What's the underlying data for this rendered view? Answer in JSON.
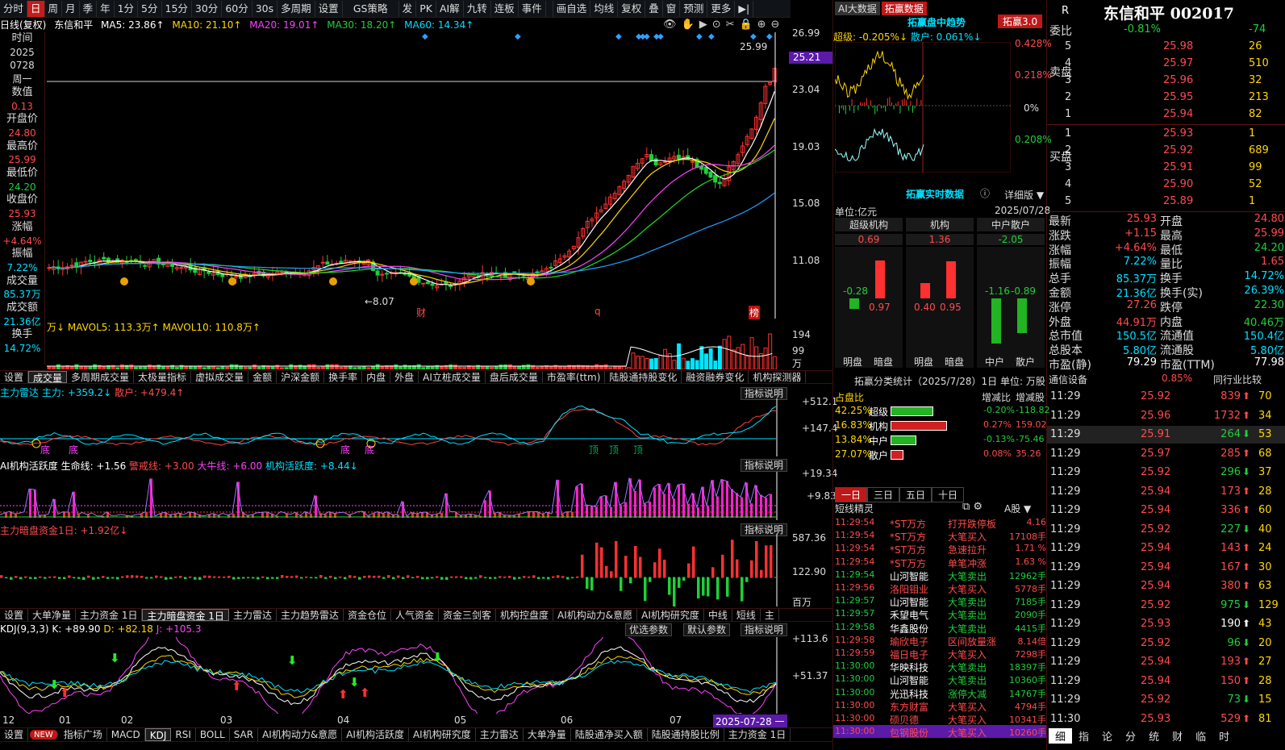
{
  "toolbar": {
    "items": [
      "分时",
      "日",
      "周",
      "月",
      "季",
      "年",
      "1分",
      "5分",
      "15分",
      "30分",
      "60分",
      "30s",
      "多周期",
      "设置",
      "GS策略",
      "发",
      "PK",
      "AI解",
      "九转",
      "连板",
      "事件",
      "",
      "画自选",
      "均线",
      "复权",
      "叠",
      "窗",
      "预测",
      "更多",
      "▶|"
    ],
    "active_index": 1
  },
  "header": {
    "mode": "日线(复权)",
    "stock": "东信和平",
    "ma5": "MA5: 23.86↑",
    "ma10": "MA10: 21.10↑",
    "ma20": "MA20: 19.01↑",
    "ma30": "MA30: 18.20↑",
    "ma60": "MA60: 14.34↑"
  },
  "left_info": [
    {
      "label": "时间",
      "value": "2025",
      "value2": "0728",
      "value3": "周一"
    },
    {
      "label": "数值",
      "value": "0.13"
    },
    {
      "label": "开盘价",
      "value": "24.80"
    },
    {
      "label": "最高价",
      "value": "25.99"
    },
    {
      "label": "最低价",
      "value": "24.20"
    },
    {
      "label": "收盘价",
      "value": "25.93"
    },
    {
      "label": "涨幅",
      "value": "+4.64%"
    },
    {
      "label": "振幅",
      "value": "7.22%"
    },
    {
      "label": "成交量",
      "value": "85.37万"
    },
    {
      "label": "成交额",
      "value": "21.36亿"
    },
    {
      "label": "换手",
      "value": "14.72%"
    }
  ],
  "price_axis": [
    "26.99",
    "25.21",
    "23.04",
    "19.03",
    "15.08",
    "11.08"
  ],
  "price_marks": {
    "high": "25.99",
    "low": "←8.07",
    "event1": "财",
    "event2": "q",
    "event3": "榜"
  },
  "volume": {
    "header": "万↓ MAVOL5: 113.3万↑ MAVOL10: 110.8万↑",
    "axis": [
      "194",
      "99",
      "万"
    ]
  },
  "tabs1": [
    "设置",
    "成交量",
    "多周期成交量",
    "太极量指标",
    "虚拟成交量",
    "金额",
    "沪深金额",
    "换手率",
    "内盘",
    "外盘",
    "AI立桩成交量",
    "盘后成交量",
    "市盈率(ttm)",
    "陆股通持股变化",
    "融资融券变化",
    "机构探测器"
  ],
  "tabs1_selected": 1,
  "radar": {
    "title": "主力雷达",
    "main": "主力: +359.2↓",
    "retail": "散户: +479.4↑",
    "axis": [
      "+512.1",
      "+147.4"
    ],
    "labels": [
      "底",
      "底",
      "顶",
      "顶",
      "顶",
      "底",
      "底"
    ]
  },
  "ai": {
    "title": "AI机构活跃度",
    "life": "生命线: +1.56",
    "warn": "警戒线: +3.00",
    "bull": "大牛线: +6.00",
    "act": "机构活跃度: +8.44↓",
    "axis": [
      "+19.34",
      "+9.83"
    ]
  },
  "dark": {
    "title": "主力暗盘资金1日: +1.92亿↓",
    "axis": [
      "587.36",
      "122.90",
      "百万"
    ]
  },
  "explain_label": "指标说明",
  "tabs2": [
    "设置",
    "大单净量",
    "主力资金 1日",
    "主力暗盘资金 1日",
    "主力雷达",
    "主力趋势雷达",
    "资金仓位",
    "人气资金",
    "资金三剑客",
    "机构控盘度",
    "AI机构动力&意愿",
    "AI机构研究度",
    "中线",
    "短线",
    "主"
  ],
  "tabs2_selected": 3,
  "kdj": {
    "title": "KDJ(9,3,3)",
    "k": "K: +89.90",
    "d": "D: +82.18",
    "j": "J: +105.3",
    "axis": [
      "+113.6",
      "+51.37"
    ],
    "btn_opt": "优选参数",
    "btn_def": "默认参数"
  },
  "dates": [
    "12",
    "01",
    "02",
    "03",
    "04",
    "05",
    "06",
    "07",
    "2025-07-28 一"
  ],
  "bottom_tabs": [
    "设置",
    "NEW",
    "指标广场",
    "MACD",
    "KDJ",
    "RSI",
    "BOLL",
    "SAR",
    "AI机构动力&意愿",
    "AI机构活跃度",
    "AI机构研究度",
    "主力雷达",
    "大单净量",
    "陆股通净买入额",
    "陆股通持股比例",
    "主力资金 1日"
  ],
  "bottom_selected": 4,
  "mid": {
    "tabs": [
      "AI大数据",
      "拓赢数据"
    ],
    "trend_title": "拓赢盘中趋势",
    "brand": "拓赢3.0",
    "super_label": "超级: -0.205%↓",
    "retail_label": "散户: 0.061%↓",
    "trend_axis": [
      "0.428%",
      "0.218%",
      "0%",
      "0.208%"
    ],
    "realtime_title": "拓赢实时数据",
    "detail": "详细版",
    "unit": "单位:亿元",
    "date": "2025/07/28",
    "groups": [
      {
        "name": "超级机构",
        "val": "0.69",
        "a": "-0.28",
        "b": "0.97",
        "la": "明盘",
        "lb": "暗盘"
      },
      {
        "name": "机构",
        "val": "1.36",
        "a": "0.40",
        "b": "0.95",
        "la": "明盘",
        "lb": "暗盘"
      },
      {
        "name": "中户散户",
        "val": "-2.05",
        "a": "-1.16",
        "b": "-0.89",
        "la": "中户",
        "lb": "散户"
      }
    ],
    "stats_title": "拓赢分类统计（2025/7/28）1日  单位: 万股",
    "stats_head": [
      "占盘比",
      "增减比",
      "增减股"
    ],
    "stats": [
      {
        "pct": "42.25%",
        "name": "超级",
        "chg": "-0.20%",
        "shares": "-118.82",
        "bar": 0.5,
        "color": "#22b422"
      },
      {
        "pct": "16.83%",
        "name": "机构",
        "chg": "0.27%",
        "shares": "159.02",
        "bar": 0.66,
        "color": "#d02020"
      },
      {
        "pct": "13.84%",
        "name": "中户",
        "chg": "-0.13%",
        "shares": "-75.46",
        "bar": 0.3,
        "color": "#22b422"
      },
      {
        "pct": "27.07%",
        "name": "散户",
        "chg": "0.08%",
        "shares": "35.26",
        "bar": 0.15,
        "color": "#d02020"
      }
    ],
    "period_tabs": [
      "一日",
      "三日",
      "五日",
      "十日"
    ],
    "sprite_title": "短线精灵",
    "sprite_market": "A股",
    "sprite": [
      [
        "11:29:54",
        "*ST万方",
        "打开跌停板",
        "4.16",
        "r"
      ],
      [
        "11:29:54",
        "*ST万方",
        "大笔买入",
        "17108手",
        "r"
      ],
      [
        "11:29:54",
        "*ST万方",
        "急速拉升",
        "1.71 %",
        "r"
      ],
      [
        "11:29:54",
        "*ST万方",
        "单笔冲涨",
        "1.63 %",
        "r"
      ],
      [
        "11:29:54",
        "山河智能",
        "大笔卖出",
        "12962手",
        "g"
      ],
      [
        "11:29:56",
        "洛阳钼业",
        "大笔买入",
        "5778手",
        "r"
      ],
      [
        "11:29:57",
        "山河智能",
        "大笔卖出",
        "7185手",
        "g"
      ],
      [
        "11:29:57",
        "禾望电气",
        "大笔卖出",
        "2090手",
        "g"
      ],
      [
        "11:29:58",
        "华鑫股份",
        "大笔卖出",
        "4415手",
        "g"
      ],
      [
        "11:29:58",
        "瑜欣电子",
        "区间放量涨",
        "8.14倍",
        "r"
      ],
      [
        "11:29:59",
        "福日电子",
        "大笔买入",
        "7298手",
        "r"
      ],
      [
        "11:30:00",
        "华映科技",
        "大笔卖出",
        "18397手",
        "g"
      ],
      [
        "11:30:00",
        "山河智能",
        "大笔卖出",
        "10360手",
        "g"
      ],
      [
        "11:30:00",
        "光迅科技",
        "涨停大减",
        "14767手",
        "g"
      ],
      [
        "11:30:00",
        "东方财富",
        "大笔买入",
        "4794手",
        "r"
      ],
      [
        "11:30:00",
        "硕贝德",
        "大笔买入",
        "10341手",
        "r"
      ],
      [
        "11:30:00",
        "包钢股份",
        "大笔买入",
        "10260手",
        "r"
      ]
    ]
  },
  "quote": {
    "r": "R",
    "title": "东信和平 002017",
    "webi_label": "委比",
    "webi": "-0.81%",
    "webi2": "-74",
    "sell_label": "卖盘",
    "buy_label": "买盘",
    "sell": [
      [
        "5",
        "25.98",
        "26"
      ],
      [
        "4",
        "25.97",
        "510"
      ],
      [
        "3",
        "25.96",
        "32"
      ],
      [
        "2",
        "25.95",
        "213"
      ],
      [
        "1",
        "25.94",
        "82"
      ]
    ],
    "buy": [
      [
        "1",
        "25.93",
        "1"
      ],
      [
        "2",
        "25.92",
        "689"
      ],
      [
        "3",
        "25.91",
        "99"
      ],
      [
        "4",
        "25.90",
        "52"
      ],
      [
        "5",
        "25.89",
        "1"
      ]
    ],
    "stats": [
      [
        "最新",
        "25.93",
        "r",
        "开盘",
        "24.80",
        "r"
      ],
      [
        "涨跌",
        "+1.15",
        "r",
        "最高",
        "25.99",
        "r"
      ],
      [
        "涨幅",
        "+4.64%",
        "r",
        "最低",
        "24.20",
        "g"
      ],
      [
        "振幅",
        "7.22%",
        "c",
        "量比",
        "1.65",
        "r"
      ],
      [
        "总手",
        "85.37万",
        "c",
        "换手",
        "14.72%",
        "c"
      ],
      [
        "金额",
        "21.36亿",
        "c",
        "换手(实)",
        "26.39%",
        "c"
      ],
      [
        "涨停",
        "27.26",
        "r",
        "跌停",
        "22.30",
        "g"
      ],
      [
        "外盘",
        "44.91万",
        "r",
        "内盘",
        "40.46万",
        "g"
      ],
      [
        "总市值",
        "150.5亿",
        "c",
        "流通值",
        "150.4亿",
        "c"
      ],
      [
        "总股本",
        "5.80亿",
        "c",
        "流通股",
        "5.80亿",
        "c"
      ],
      [
        "市盈(静)",
        "79.29",
        "w",
        "市盈(TTM)",
        "77.98",
        "w"
      ]
    ],
    "industry": "通信设备",
    "industry_pct": "0.85%",
    "industry_rank": "同行业比较",
    "ticks": [
      [
        "11:29",
        "25.92",
        "839",
        "up",
        "70"
      ],
      [
        "11:29",
        "25.96",
        "1732",
        "up",
        "34"
      ],
      [
        "11:29",
        "25.91",
        "264",
        "dn",
        "53"
      ],
      [
        "11:29",
        "25.97",
        "285",
        "up",
        "68"
      ],
      [
        "11:29",
        "25.92",
        "296",
        "dn",
        "37"
      ],
      [
        "11:29",
        "25.94",
        "173",
        "up",
        "28"
      ],
      [
        "11:29",
        "25.94",
        "336",
        "up",
        "60"
      ],
      [
        "11:29",
        "25.92",
        "227",
        "dn",
        "40"
      ],
      [
        "11:29",
        "25.94",
        "143",
        "up",
        "24"
      ],
      [
        "11:29",
        "25.94",
        "167",
        "up",
        "30"
      ],
      [
        "11:29",
        "25.94",
        "380",
        "up",
        "63"
      ],
      [
        "11:29",
        "25.92",
        "975",
        "dn",
        "129"
      ],
      [
        "11:29",
        "25.93",
        "190",
        "wu",
        "43"
      ],
      [
        "11:29",
        "25.92",
        "96",
        "dn",
        "20"
      ],
      [
        "11:29",
        "25.94",
        "193",
        "up",
        "27"
      ],
      [
        "11:29",
        "25.94",
        "150",
        "up",
        "28"
      ],
      [
        "11:29",
        "25.92",
        "73",
        "dn",
        "15"
      ],
      [
        "11:30",
        "25.93",
        "529",
        "up",
        "81"
      ]
    ],
    "foot_tabs": [
      "细",
      "指",
      "论",
      "分",
      "统",
      "财",
      "临",
      "时"
    ]
  }
}
